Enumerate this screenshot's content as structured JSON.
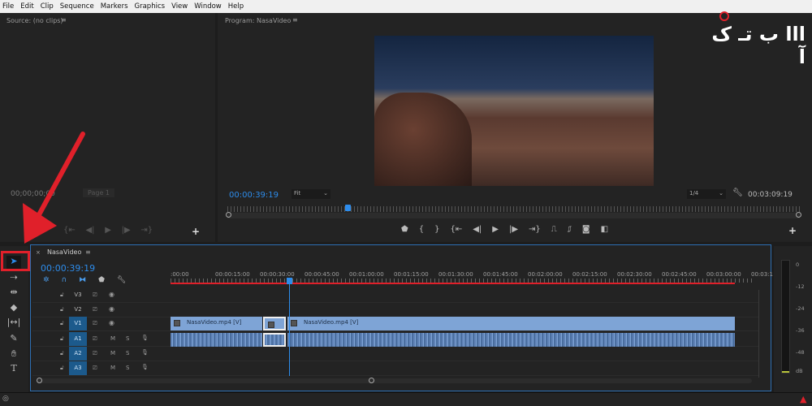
{
  "menu": [
    "File",
    "Edit",
    "Clip",
    "Sequence",
    "Markers",
    "Graphics",
    "View",
    "Window",
    "Help"
  ],
  "logo": {
    "text": "آکتی بازار",
    "color": "#e0202a"
  },
  "source": {
    "title": "Source: (no clips)",
    "timecode": "00;00;00;00",
    "page": "Page 1"
  },
  "program": {
    "title": "Program: NasaVideo",
    "timecode": "00:00:39:19",
    "fit": "Fit",
    "resolution": "1/4",
    "duration": "00:03:09:19",
    "playhead_fraction": 0.21
  },
  "timeline": {
    "sequence": "NasaVideo",
    "timecode": "00:00:39:19",
    "ruler": [
      ":00:00",
      "00:00:15:00",
      "00:00:30:00",
      "00:00:45:00",
      "00:01:00:00",
      "00:01:15:00",
      "00:01:30:00",
      "00:01:45:00",
      "00:02:00:00",
      "00:02:15:00",
      "00:02:30:00",
      "00:02:45:00",
      "00:03:00:00",
      "00:03:1"
    ],
    "video_tracks": [
      "V3",
      "V2",
      "V1"
    ],
    "audio_tracks": [
      "A1",
      "A2",
      "A3"
    ],
    "mute": "M",
    "solo": "S",
    "clips": [
      "NasaVideo.mp4 [V]",
      "NasaVideo.mp4 [V]"
    ]
  },
  "meter": [
    "0",
    "-12",
    "-24",
    "-36",
    "-48",
    "dB"
  ],
  "colors": {
    "accent": "#2d8ceb",
    "annotation": "#e0202a",
    "clip": "#7ea4d6"
  }
}
